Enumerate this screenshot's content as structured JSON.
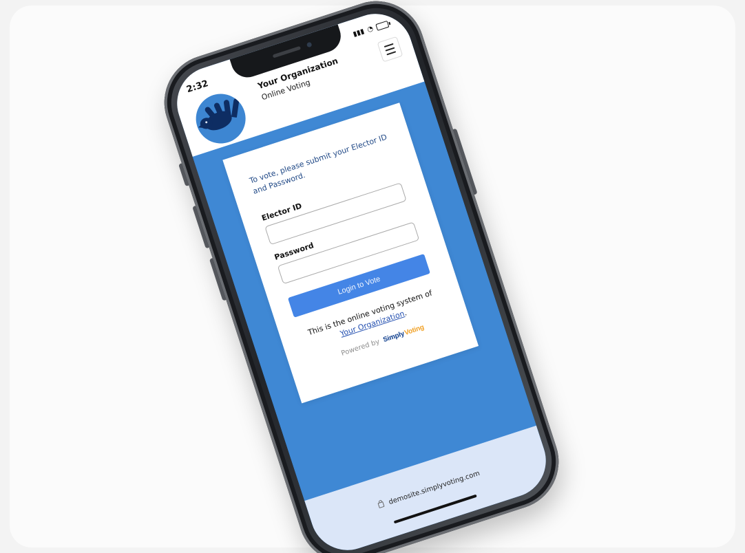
{
  "status_bar": {
    "time": "2:32"
  },
  "header": {
    "organization": "Your Organization",
    "subtitle": "Online Voting",
    "menu_icon": "menu-icon"
  },
  "login": {
    "instruction": "To vote, please submit your Elector ID and Password.",
    "elector_label": "Elector ID",
    "elector_value": "",
    "password_label": "Password",
    "password_value": "",
    "button_label": "Login to Vote"
  },
  "footer_text": {
    "prefix": "This is the online voting system of",
    "organization_link": "Your Organization",
    "suffix": ".",
    "powered_by": "Powered by",
    "brand_part_1": "Simply",
    "brand_part_2": "Voting"
  },
  "browser": {
    "url": "demosite.simplyvoting.com"
  },
  "colors": {
    "primary_blue": "#3f88d4",
    "button_blue": "#4485e6",
    "logo_navy": "#0e2d63",
    "brand_orange": "#f1a126"
  }
}
